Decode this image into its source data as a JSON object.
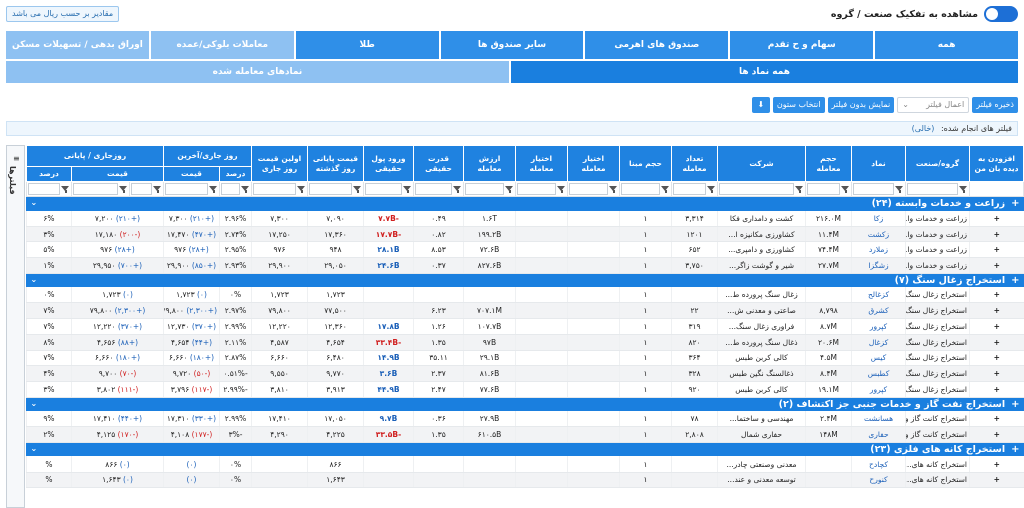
{
  "header": {
    "toggle_label": "مشاهده به تفکیک صنعت / گروه",
    "toggle_on": true,
    "unit_note": "مقادیر بر حسب ریال می باشد"
  },
  "tabs_row1": [
    {
      "label": "همه",
      "active": true
    },
    {
      "label": "سهام و ح تقدم",
      "active": true
    },
    {
      "label": "صندوق های اهرمی",
      "active": true
    },
    {
      "label": "سایر صندوق ها",
      "active": true
    },
    {
      "label": "طلا",
      "active": true
    },
    {
      "label": "معاملات بلوکی/عمده",
      "active": false
    },
    {
      "label": "اوراق بدهی / تسهیلات مسکن",
      "active": false
    }
  ],
  "tabs_row2": [
    {
      "label": "همه نماد ها",
      "active": true
    },
    {
      "label": "نمادهای معامله شده",
      "active": false
    }
  ],
  "toolbar": {
    "save_filter": "ذخیره فیلتر",
    "apply_filter_placeholder": "اعمال فیلتر",
    "show_without_filter": "نمایش بدون فیلتر",
    "select_columns": "انتخاب ستون"
  },
  "filters_done": {
    "label": "فیلتر های انجام شده:",
    "value": "(خالی)"
  },
  "side_label": "فیلترها",
  "columns": {
    "add": "افزودن به دیده بان من",
    "group": "گروه/صنعت",
    "symbol": "نماد",
    "volume": "حجم معامله",
    "company": "شرکت",
    "count": "تعداد معامله",
    "base_vol": "حجم مبنا",
    "option1": "اختیار معامله",
    "option2": "اختیار معامله",
    "value": "ارزش معامله",
    "power": "قدرت حقیقی",
    "money_in": "ورود پول حقیقی",
    "prev_close": "قیمت پایانی روز گذشته",
    "first_price": "اولین قیمت روز جاری",
    "today_last": "روز جاری/آخرین",
    "today_close": "روزجاری / پایانی",
    "price": "قیمت",
    "percent": "درصد"
  },
  "groups": [
    {
      "title": "زراعت و خدمات وابسته (۲۴)",
      "rows": [
        {
          "group": "زراعت و خدمات وا...",
          "symbol": "زکا",
          "volume": "۲۱۶.۰M",
          "company": "کشت و دامداری فکا",
          "count": "۳,۳۱۴",
          "base": "۱",
          "opt1": "",
          "opt2": "",
          "value": "۱.۶T",
          "power": "۰.۴۹",
          "money": "-۷.۷B",
          "money_sign": "neg",
          "prev": "۷,۰۹۰",
          "first": "۷,۳۰۰",
          "last_pct": "۲.۹۶%",
          "last_price": "۷,۳۰۰",
          "last_chg": "(+۲۱۰)",
          "last_sign": "pos",
          "close_pct": "۶%",
          "close_price": "۷,۲۰۰",
          "close_chg": "(+۲۱۰)",
          "close_sign": "pos"
        },
        {
          "group": "زراعت و خدمات وا...",
          "symbol": "زکشت",
          "volume": "۱۱.۴M",
          "company": "کشاورزی مکانیزه ا...",
          "count": "۱۲۰۱",
          "base": "۱",
          "opt1": "",
          "opt2": "",
          "value": "۱۹۹.۲B",
          "power": "۰.۸۲",
          "money": "-۱۷.۷B",
          "money_sign": "neg",
          "prev": "۱۷,۳۶۰",
          "first": "۱۷,۲۵۰",
          "last_pct": "۲.۷۴%",
          "last_price": "۱۷,۴۷۰",
          "last_chg": "(+۴۷۰)",
          "last_sign": "pos",
          "close_pct": "۳%",
          "close_price": "۱۷,۱۸۰",
          "close_chg": "(-۲۰۰)",
          "close_sign": "neg"
        },
        {
          "group": "زراعت و خدمات وا...",
          "symbol": "زملارد",
          "volume": "۷۴.۴M",
          "company": "کشاورزی و دامپری...",
          "count": "۶۵۲",
          "base": "۱",
          "opt1": "",
          "opt2": "",
          "value": "۷۲.۶B",
          "power": "۸.۵۳",
          "money": "۲۸.۱B",
          "money_sign": "pos",
          "prev": "۹۴۸",
          "first": "۹۷۶",
          "last_pct": "۲.۹۵%",
          "last_price": "۹۷۶",
          "last_chg": "(+۲۸)",
          "last_sign": "pos",
          "close_pct": "۵%",
          "close_price": "۹۷۶",
          "close_chg": "(+۲۸)",
          "close_sign": "pos"
        },
        {
          "group": "زراعت و خدمات وا...",
          "symbol": "زشگزا",
          "volume": "۲۷.۷M",
          "company": "شیر و گوشت زاگر...",
          "count": "۳,۷۵۰",
          "base": "۱",
          "opt1": "",
          "opt2": "",
          "value": "۸۲۷.۶B",
          "power": "۰.۳۷",
          "money": "۲۴.۶B",
          "money_sign": "pos",
          "prev": "۲۹,۰۵۰",
          "first": "۲۹,۹۰۰",
          "last_pct": "۲.۹۳%",
          "last_price": "۲۹,۹۰۰",
          "last_chg": "(+۸۵۰)",
          "last_sign": "pos",
          "close_pct": "۱%",
          "close_price": "۲۹,۹۵۰",
          "close_chg": "(+۷۰۰)",
          "close_sign": "pos"
        }
      ]
    },
    {
      "title": "استخراج زغال سنگ (۷)",
      "rows": [
        {
          "group": "استخراج زغال سنگ",
          "symbol": "کزغالح",
          "volume": "",
          "company": "زغال سنگ پرورده ط...",
          "count": "",
          "base": "۱",
          "opt1": "",
          "opt2": "",
          "value": "",
          "power": "",
          "money": "",
          "money_sign": "",
          "prev": "۱,۷۲۳",
          "first": "۱,۷۲۳",
          "last_pct": "۰%",
          "last_price": "۱,۷۲۳",
          "last_chg": "(۰)",
          "last_sign": "pos",
          "close_pct": "۰%",
          "close_price": "۱,۷۲۳",
          "close_chg": "(۰)",
          "close_sign": "pos"
        },
        {
          "group": "استخراج زغال سنگ",
          "symbol": "کشرق",
          "volume": "۸,۷۹۸",
          "company": "صاعتی و معدنی ش...",
          "count": "۲۲",
          "base": "۱",
          "opt1": "",
          "opt2": "",
          "value": "۷۰۷.۱M",
          "power": "۶.۲۳",
          "money": "",
          "money_sign": "",
          "prev": "۷۷,۵۰۰",
          "first": "۷۹,۸۰۰",
          "last_pct": "۲.۹۷%",
          "last_price": "۷۹,۸۰۰",
          "last_chg": "(+۲,۳۰۰)",
          "last_sign": "pos",
          "close_pct": "۷%",
          "close_price": "۷۹,۸۰۰",
          "close_chg": "(+۲,۳۰۰)",
          "close_sign": "pos"
        },
        {
          "group": "استخراج زغال سنگ",
          "symbol": "کپرور",
          "volume": "۸.۷M",
          "company": "فراوری زغال سنگ...",
          "count": "۳۱۹",
          "base": "۱",
          "opt1": "",
          "opt2": "",
          "value": "۱۰۷.۷B",
          "power": "۱.۲۶",
          "money": "۱۷.۸B",
          "money_sign": "pos",
          "prev": "۱۲,۳۶۰",
          "first": "۱۲,۲۲۰",
          "last_pct": "۲.۹۹%",
          "last_price": "۱۲,۷۳۰",
          "last_chg": "(+۳۷۰)",
          "last_sign": "pos",
          "close_pct": "۷%",
          "close_price": "۱۲,۲۲۰",
          "close_chg": "(+۳۷۰)",
          "close_sign": "pos"
        },
        {
          "group": "استخراج زغال سنگ",
          "symbol": "کزغال",
          "volume": "۲۰.۶M",
          "company": "ذغال سنگ پرورده ط...",
          "count": "۸۲۰",
          "base": "۱",
          "opt1": "",
          "opt2": "",
          "value": "۹۷B",
          "power": "۱.۳۵",
          "money": "-۳۳.۴B",
          "money_sign": "neg",
          "prev": "۴,۶۵۴",
          "first": "۴,۵۸۷",
          "last_pct": "۲.۱۱%",
          "last_price": "۴,۶۵۴",
          "last_chg": "(+۴۴)",
          "last_sign": "pos",
          "close_pct": "۸%",
          "close_price": "۴,۶۵۶",
          "close_chg": "(+۸۸)",
          "close_sign": "pos"
        },
        {
          "group": "استخراج زغال سنگ",
          "symbol": "کیس",
          "volume": "۴.۵M",
          "company": "کالی کربن طبس",
          "count": "۳۶۴",
          "base": "۱",
          "opt1": "",
          "opt2": "",
          "value": "۲۹.۱B",
          "power": "۳۵.۱۱",
          "money": "۱۴.۹B",
          "money_sign": "pos",
          "prev": "۶,۴۸۰",
          "first": "۶,۶۶۰",
          "last_pct": "۲.۸۷%",
          "last_price": "۶,۶۶۰",
          "last_chg": "(+۱۸۰)",
          "last_sign": "pos",
          "close_pct": "۷%",
          "close_price": "۶,۶۶۰",
          "close_chg": "(+۱۸۰)",
          "close_sign": "pos"
        },
        {
          "group": "استخراج زغال سنگ",
          "symbol": "کطبس",
          "volume": "۸.۴M",
          "company": "ذغالسنگ نگین طبس",
          "count": "۳۲۸",
          "base": "۱",
          "opt1": "",
          "opt2": "",
          "value": "۸۱.۶B",
          "power": "۲.۳۷",
          "money": "۳.۶B",
          "money_sign": "pos",
          "prev": "۹,۷۷۰",
          "first": "۹,۵۵۰",
          "last_pct": "-۰.۵۱%",
          "last_price": "۹,۷۲۰",
          "last_chg": "(-۵۰)",
          "last_sign": "neg",
          "close_pct": "۴%",
          "close_price": "۹,۷۰۰",
          "close_chg": "(-۷۰)",
          "close_sign": "neg"
        },
        {
          "group": "استخراج زغال سنگ",
          "symbol": "کپرور",
          "volume": "۱۹.۱M",
          "company": "کالی کربن طبس",
          "count": "۹۲۰",
          "base": "۱",
          "opt1": "",
          "opt2": "",
          "value": "۷۷.۶B",
          "power": "۲.۴۷",
          "money": "۴۴.۹B",
          "money_sign": "pos",
          "prev": "۳,۹۱۳",
          "first": "۳,۸۱۰",
          "last_pct": "-۲.۹۹%",
          "last_price": "۳,۷۹۶",
          "last_chg": "(-۱۱۷)",
          "last_sign": "neg",
          "close_pct": "۳%",
          "close_price": "۳,۸۰۲",
          "close_chg": "(-۱۱۱)",
          "close_sign": "neg"
        }
      ]
    },
    {
      "title": "استخراج نفت گاز و خدمات جنبی جز اکتشاف (۲)",
      "rows": [
        {
          "group": "استخراج کانت گاز و ...",
          "symbol": "هسانشت",
          "volume": "۲.۴M",
          "company": "مهندسی و ساختما...",
          "count": "۷۸",
          "base": "۱",
          "opt1": "",
          "opt2": "",
          "value": "۲۷.۹B",
          "power": "۰.۳۶",
          "money": "۹.۷B",
          "money_sign": "pos",
          "prev": "۱۷,۰۵۰",
          "first": "۱۷,۴۱۰",
          "last_pct": "۲.۹۹%",
          "last_price": "۱۷,۳۱۰",
          "last_chg": "(+۳۳۰)",
          "last_sign": "pos",
          "close_pct": "۹%",
          "close_price": "۱۷,۴۱۰",
          "close_chg": "(+۴۴۰)",
          "close_sign": "pos"
        },
        {
          "group": "استخراج کانت گاز و ...",
          "symbol": "حفاری",
          "volume": "۱۴۸M",
          "company": "حفاری شمال",
          "count": "۲,۸۰۸",
          "base": "۱",
          "opt1": "",
          "opt2": "",
          "value": "۶۱۰.۵B",
          "power": "۱.۳۵",
          "money": "-۳۳.۵B",
          "money_sign": "neg",
          "prev": "۴,۲۲۵",
          "first": "۴,۲۹۰",
          "last_pct": "-۳%",
          "last_price": "۴,۱۰۸",
          "last_chg": "(-۱۷۷)",
          "last_sign": "neg",
          "close_pct": "۲%",
          "close_price": "۴,۱۲۵",
          "close_chg": "(-۱۷۰)",
          "close_sign": "neg"
        }
      ]
    },
    {
      "title": "استخراج کانه های فلزی (۲۳)",
      "rows": [
        {
          "group": "استخراج کانه های...",
          "symbol": "کچادح",
          "volume": "",
          "company": "معدنی وصنعتی چادر...",
          "count": "",
          "base": "۱",
          "opt1": "",
          "opt2": "",
          "value": "",
          "power": "",
          "money": "",
          "money_sign": "",
          "prev": "۸۶۶",
          "first": "",
          "last_pct": "۰%",
          "last_price": "",
          "last_chg": "(۰)",
          "last_sign": "pos",
          "close_pct": "%",
          "close_price": "۸۶۶",
          "close_chg": "(۰)",
          "close_sign": "pos"
        },
        {
          "group": "استخراج کانه های...",
          "symbol": "کنورح",
          "volume": "",
          "company": "توسعه معدنی و عند...",
          "count": "",
          "base": "۱",
          "opt1": "",
          "opt2": "",
          "value": "",
          "power": "",
          "money": "",
          "money_sign": "",
          "prev": "۱,۶۴۳",
          "first": "",
          "last_pct": "۰%",
          "last_price": "",
          "last_chg": "(۰)",
          "last_sign": "pos",
          "close_pct": "%",
          "close_price": "۱,۶۴۳",
          "close_chg": "(۰)",
          "close_sign": "pos"
        }
      ]
    }
  ]
}
